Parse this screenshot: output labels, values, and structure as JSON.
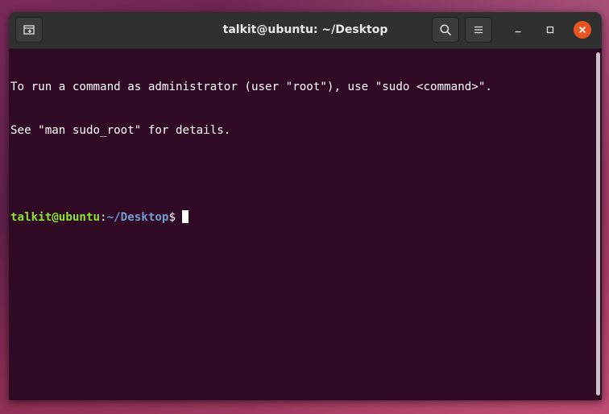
{
  "window": {
    "title": "talkit@ubuntu: ~/Desktop"
  },
  "header_buttons": {
    "new_tab_icon": "new-tab-icon",
    "search_icon": "search-icon",
    "menu_icon": "hamburger-menu-icon",
    "minimize_icon": "minimize-icon",
    "maximize_icon": "maximize-icon",
    "close_icon": "close-icon"
  },
  "terminal": {
    "lines": [
      "To run a command as administrator (user \"root\"), use \"sudo <command>\".",
      "See \"man sudo_root\" for details."
    ],
    "prompt": {
      "user_host": "talkit@ubuntu",
      "colon": ":",
      "path": "~/Desktop",
      "dollar": "$"
    }
  },
  "colors": {
    "terminal_bg": "#300a24",
    "prompt_user": "#8ae234",
    "prompt_path": "#729fcf",
    "close_button": "#e95420",
    "headerbar": "#303030"
  }
}
